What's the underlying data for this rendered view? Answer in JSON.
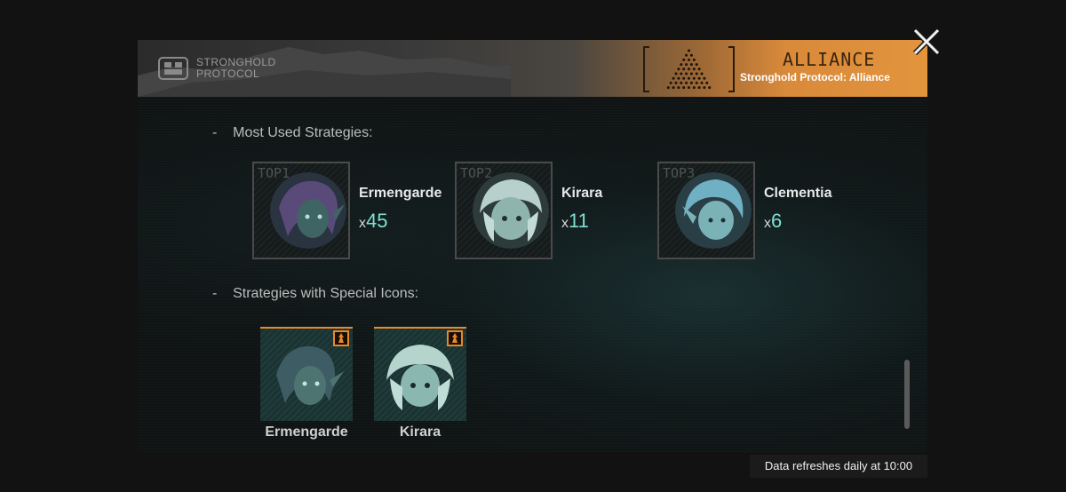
{
  "header": {
    "brand_line1": "STRONGHOLD",
    "brand_line2": "PROTOCOL",
    "alliance_word": "ALLIANCE",
    "alliance_subtitle": "Stronghold Protocol: Alliance"
  },
  "close": {
    "icon": "close-icon"
  },
  "sections": {
    "most_used_title": "Most Used Strategies:",
    "special_icons_title": "Strategies with Special Icons:",
    "bullet": "-"
  },
  "most_used": [
    {
      "rank": "TOP1",
      "name": "Ermengarde",
      "prefix": "x",
      "count": "45",
      "color": "#6a5a8a"
    },
    {
      "rank": "TOP2",
      "name": "Kirara",
      "prefix": "x",
      "count": "11",
      "color": "#a8c8c4"
    },
    {
      "rank": "TOP3",
      "name": "Clementia",
      "prefix": "x",
      "count": "6",
      "color": "#7ab8c8"
    }
  ],
  "special_icons": [
    {
      "name": "Ermengarde",
      "color": "#4e7472"
    },
    {
      "name": "Kirara",
      "color": "#8ab8b0"
    }
  ],
  "footer": {
    "note": "Data refreshes daily at 10:00"
  },
  "colors": {
    "accent": "#e58a2a",
    "count": "#7fe0d0"
  }
}
